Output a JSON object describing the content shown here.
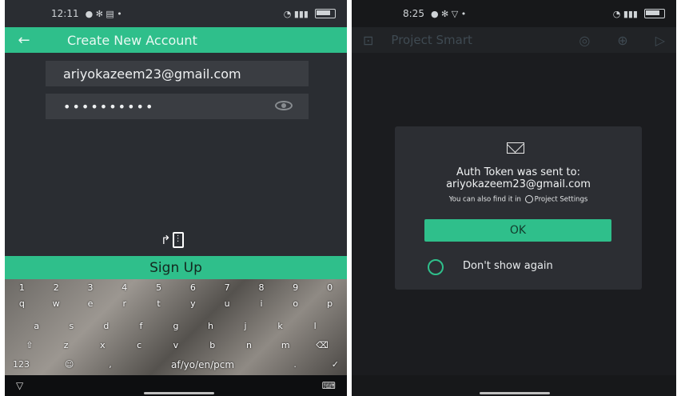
{
  "left": {
    "status": {
      "time": "12:11"
    },
    "title": "Create New Account",
    "email_value": "ariyokazeem23@gmail.com",
    "password_mask": "••••••••••",
    "signup_label": "Sign Up",
    "keyboard": {
      "row_numbers": [
        "1",
        "2",
        "3",
        "4",
        "5",
        "6",
        "7",
        "8",
        "9",
        "0"
      ],
      "row1": [
        "q",
        "w",
        "e",
        "r",
        "t",
        "y",
        "u",
        "i",
        "o",
        "p"
      ],
      "row2": [
        "a",
        "s",
        "d",
        "f",
        "g",
        "h",
        "j",
        "k",
        "l"
      ],
      "row3": [
        "z",
        "x",
        "c",
        "v",
        "b",
        "n",
        "m"
      ],
      "bottom_left": "123",
      "space_label": "af/yo/en/pcm"
    }
  },
  "right": {
    "status": {
      "time": "8:25"
    },
    "title": "Project Smart",
    "dialog": {
      "message_line1": "Auth Token was sent to:",
      "message_line2": "ariyokazeem23@gmail.com",
      "note_prefix": "You can also find it in",
      "note_suffix": "Project Settings",
      "ok_label": "OK",
      "dont_show_label": "Don't show again"
    }
  },
  "colors": {
    "accent": "#2fbf8b",
    "background_left": "#2a2d32",
    "background_right": "#1b1c1f"
  }
}
